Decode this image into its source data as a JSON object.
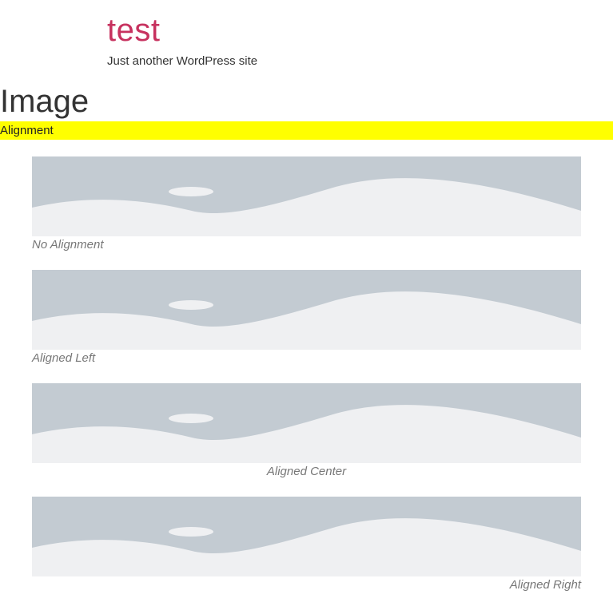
{
  "header": {
    "site_title": "test",
    "tagline": "Just another WordPress site"
  },
  "page": {
    "title": "Image",
    "section_heading": "Alignment"
  },
  "figures": [
    {
      "caption": "No Alignment",
      "icon": "image-placeholder-icon"
    },
    {
      "caption": "Aligned Left",
      "icon": "image-placeholder-icon"
    },
    {
      "caption": "Aligned Center",
      "icon": "image-placeholder-icon"
    },
    {
      "caption": "Aligned Right",
      "icon": "image-placeholder-icon"
    }
  ],
  "colors": {
    "title_accent": "#c7325f",
    "heading_highlight": "#ffff00",
    "placeholder_sky": "#c3cbd2",
    "placeholder_ground": "#eff0f2",
    "caption_text": "#777777"
  }
}
